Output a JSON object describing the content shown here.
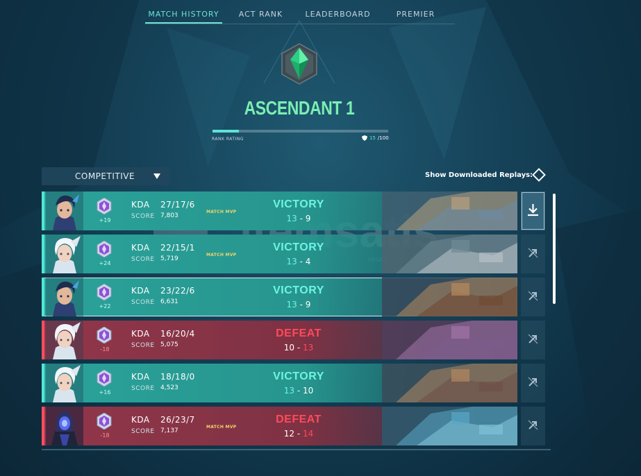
{
  "nav": {
    "tabs": [
      {
        "label": "MATCH HISTORY",
        "active": true
      },
      {
        "label": "ACT RANK",
        "active": false
      },
      {
        "label": "LEADERBOARD",
        "active": false
      },
      {
        "label": "PREMIER",
        "active": false
      }
    ]
  },
  "rank": {
    "title": "ASCENDANT 1",
    "rating_label": "RANK RATING",
    "rating_current": "15",
    "rating_max": "/100",
    "rating_fraction": 0.15,
    "emblem_icon": "ascendant-emblem",
    "colors": {
      "title": "#7aefb2",
      "accent": "#5ee3d6",
      "emblem": "#34c77f"
    }
  },
  "controls": {
    "mode": "COMPETITIVE",
    "replays_label": "Show Downloaded Replays:"
  },
  "matches": [
    {
      "result": "VICTORY",
      "outcome": "win",
      "rr_change": "+19",
      "kda_label": "KDA",
      "kda": "27/17/6",
      "score_label": "SCORE",
      "score": "7,803",
      "mvp": "MATCH MVP",
      "team_score": "13",
      "enemy_score": "9",
      "agent_icon": "agent-neon",
      "map_icon": "map-thumbnail",
      "replay_icon": "download-icon"
    },
    {
      "result": "VICTORY",
      "outcome": "win",
      "rr_change": "+24",
      "kda_label": "KDA",
      "kda": "22/15/1",
      "score_label": "SCORE",
      "score": "5,719",
      "mvp": "MATCH MVP",
      "team_score": "13",
      "enemy_score": "4",
      "agent_icon": "agent-jett",
      "map_icon": "map-thumbnail",
      "replay_icon": "replay-unavailable-icon"
    },
    {
      "result": "VICTORY",
      "outcome": "win",
      "rr_change": "+22",
      "kda_label": "KDA",
      "kda": "23/22/6",
      "score_label": "SCORE",
      "score": "6,631",
      "mvp": "",
      "team_score": "13",
      "enemy_score": "9",
      "agent_icon": "agent-neon",
      "map_icon": "map-thumbnail",
      "replay_icon": "replay-unavailable-icon"
    },
    {
      "result": "DEFEAT",
      "outcome": "loss",
      "rr_change": "-18",
      "kda_label": "KDA",
      "kda": "16/20/4",
      "score_label": "SCORE",
      "score": "5,075",
      "mvp": "",
      "team_score": "10",
      "enemy_score": "13",
      "agent_icon": "agent-jett",
      "map_icon": "map-thumbnail",
      "replay_icon": "replay-unavailable-icon"
    },
    {
      "result": "VICTORY",
      "outcome": "win",
      "rr_change": "+16",
      "kda_label": "KDA",
      "kda": "18/18/0",
      "score_label": "SCORE",
      "score": "4,523",
      "mvp": "",
      "team_score": "13",
      "enemy_score": "10",
      "agent_icon": "agent-jett",
      "map_icon": "map-thumbnail",
      "replay_icon": "replay-unavailable-icon"
    },
    {
      "result": "DEFEAT",
      "outcome": "loss",
      "rr_change": "-18",
      "kda_label": "KDA",
      "kda": "26/23/7",
      "score_label": "SCORE",
      "score": "7,137",
      "mvp": "MATCH MVP",
      "team_score": "12",
      "enemy_score": "14",
      "agent_icon": "agent-reyna",
      "map_icon": "map-thumbnail",
      "replay_icon": "replay-unavailable-icon"
    }
  ],
  "watermark": {
    "text": "itemsatis",
    "sub1": "HESAP",
    "sub2": ".com"
  },
  "colors": {
    "win": "#2aa39a",
    "win_accent": "#6ef5e1",
    "loss": "#93364a",
    "loss_accent": "#ff4a5a",
    "mvp": "#f3d46b"
  }
}
